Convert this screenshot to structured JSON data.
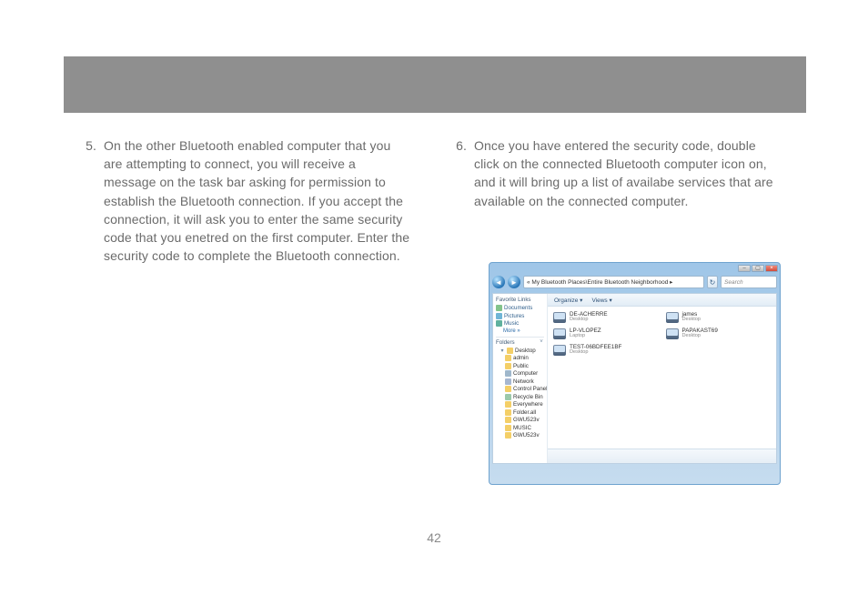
{
  "page_number": "42",
  "steps": [
    {
      "num": "5.",
      "text": "On the other Bluetooth enabled computer that you are attempting to connect, you will receive a message on the task bar asking for permission to establish the Bluetooth connection. If you accept the connection, it will ask you to enter the same security code that you enetred on the first computer.  Enter the security code to complete the Bluetooth connection."
    },
    {
      "num": "6.",
      "text": "Once you have entered the security code, double click on the connected Bluetooth computer icon on, and it will bring up a list of availabe services that are available on the connected computer."
    }
  ],
  "explorer": {
    "address": "« My Bluetooth Places\\Entire Bluetooth Neighborhood ▸",
    "search_placeholder": "Search",
    "toolbar": {
      "organize": "Organize ▾",
      "views": "Views ▾"
    },
    "favorites_header": "Favorite Links",
    "favorites": [
      {
        "icon": "doc",
        "label": "Documents"
      },
      {
        "icon": "pic",
        "label": "Pictures"
      },
      {
        "icon": "mus",
        "label": "Music"
      }
    ],
    "more_label": "More »",
    "folders_header": "Folders",
    "tree": [
      {
        "lvl": 1,
        "icon": "fld",
        "label": "Desktop"
      },
      {
        "lvl": 2,
        "icon": "fld",
        "label": "admin"
      },
      {
        "lvl": 2,
        "icon": "fld",
        "label": "Public"
      },
      {
        "lvl": 2,
        "icon": "cmp",
        "label": "Computer"
      },
      {
        "lvl": 2,
        "icon": "net",
        "label": "Network"
      },
      {
        "lvl": 2,
        "icon": "fld",
        "label": "Control Panel"
      },
      {
        "lvl": 2,
        "icon": "rcy",
        "label": "Recycle Bin"
      },
      {
        "lvl": 2,
        "icon": "fld",
        "label": "Everywhere"
      },
      {
        "lvl": 2,
        "icon": "fld",
        "label": "Folder.all"
      },
      {
        "lvl": 2,
        "icon": "fld",
        "label": "GWU523v"
      },
      {
        "lvl": 2,
        "icon": "fld",
        "label": "MUSIC"
      },
      {
        "lvl": 2,
        "icon": "fld",
        "label": "GWU523v"
      }
    ],
    "devices": [
      {
        "name": "DE-ACHERRE",
        "sub": "Desktop"
      },
      {
        "name": "james",
        "sub": "Desktop"
      },
      {
        "name": "LP-VLOPEZ",
        "sub": "Laptop"
      },
      {
        "name": "PAPAKAST69",
        "sub": "Desktop"
      },
      {
        "name": "TEST-06BDFEE1BF",
        "sub": "Desktop"
      },
      {
        "name": "",
        "sub": ""
      }
    ],
    "window_buttons": {
      "min": "–",
      "max": "▢",
      "close": "×"
    },
    "nav": {
      "back": "◄",
      "fwd": "►",
      "refresh": "↻"
    }
  }
}
